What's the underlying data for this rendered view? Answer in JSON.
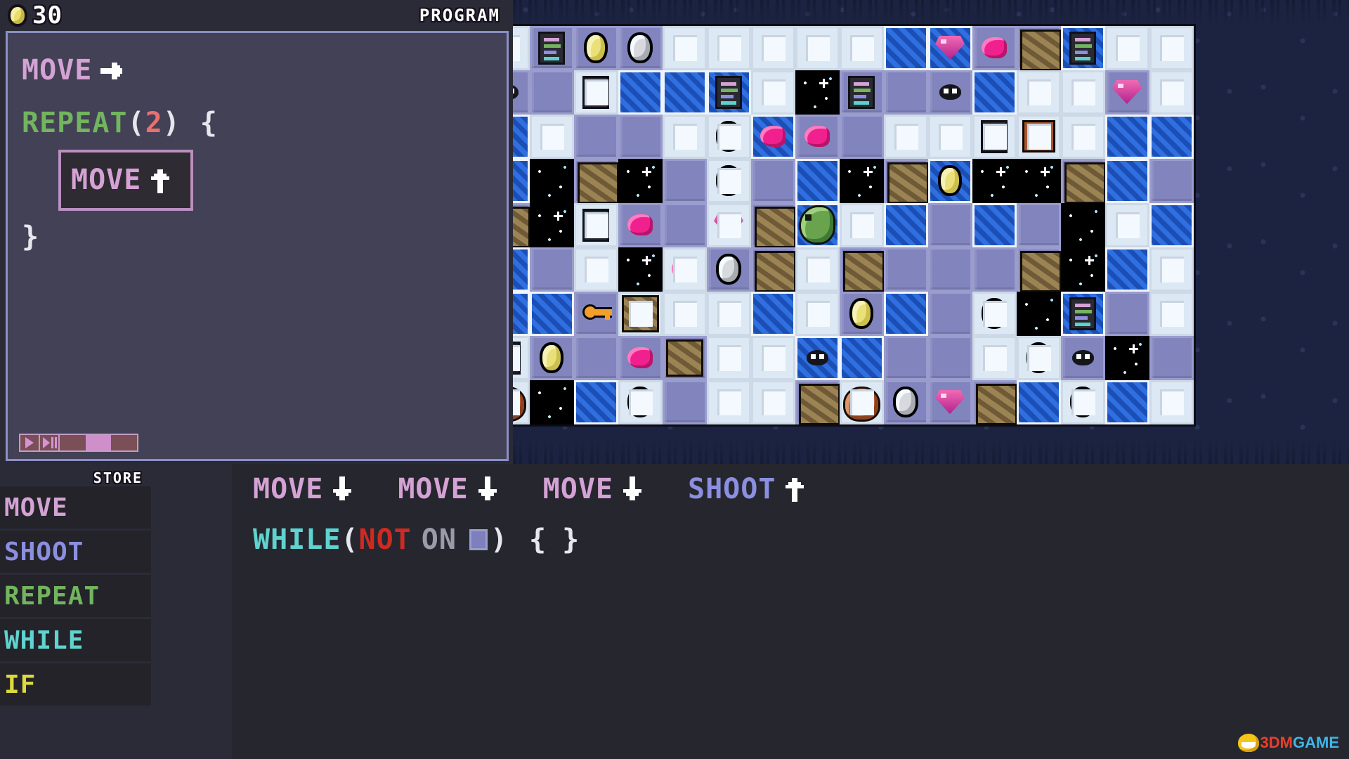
{
  "header": {
    "coin_count": "30",
    "program_label": "PROGRAM",
    "coin_icon": "coin-icon"
  },
  "program": {
    "lines": [
      {
        "keyword": "MOVE",
        "kind": "move",
        "arrow": "right",
        "selected": false,
        "indent": 0
      },
      {
        "keyword": "REPEAT",
        "kind": "repeat",
        "paren_open": "(",
        "count": "2",
        "paren_close": ")",
        "brace": "{",
        "indent": 0
      },
      {
        "keyword": "MOVE",
        "kind": "move",
        "arrow": "up",
        "selected": true,
        "indent": 1
      },
      {
        "brace_close": "}",
        "indent": 0
      }
    ],
    "transport": {
      "play_label": "play-button",
      "step_label": "step-button",
      "speed_segments": 3,
      "speed_active_index": 1
    }
  },
  "store": {
    "title": "STORE",
    "items": [
      {
        "label": "MOVE",
        "color": "#d4a2d4"
      },
      {
        "label": "SHOOT",
        "color": "#8c8fe0"
      },
      {
        "label": "REPEAT",
        "color": "#72b45f"
      },
      {
        "label": "WHILE",
        "color": "#5fd3cf"
      },
      {
        "label": "IF",
        "color": "#ddd93f"
      }
    ]
  },
  "tray": {
    "row1": [
      {
        "label": "MOVE",
        "kind": "move",
        "arrow": "down"
      },
      {
        "label": "MOVE",
        "kind": "move",
        "arrow": "down"
      },
      {
        "label": "MOVE",
        "kind": "move",
        "arrow": "down"
      },
      {
        "label": "SHOOT",
        "kind": "shoot",
        "arrow": "up"
      }
    ],
    "row2": {
      "while": "WHILE",
      "paren_open": "(",
      "not": "NOT",
      "on": "ON",
      "tile_icon": "purple-tile-icon",
      "paren_close": ")",
      "brace_open": "{",
      "brace_close": "}"
    }
  },
  "board": {
    "cols": 16,
    "rows": 9,
    "tiles": [
      [
        "light",
        "purple:tablet",
        "purple:coin",
        "purple:orb",
        "light",
        "light",
        "light",
        "light",
        "light",
        "blue",
        "blue:gem",
        "purple:blob",
        "rock",
        "blue:tablet",
        "light",
        "light"
      ],
      [
        "purple:bug",
        "purple",
        "light:tablet",
        "blue",
        "blue",
        "blue:tablet",
        "light",
        "space:spark",
        "purple:tablet",
        "purple",
        "purple:bug",
        "blue",
        "light",
        "light",
        "purple:gem",
        "light"
      ],
      [
        "blue",
        "light",
        "purple",
        "purple",
        "light",
        "light:orb",
        "blue:blob",
        "purple:blob",
        "purple",
        "light",
        "light",
        "light:tablet",
        "chest",
        "light:bug",
        "blue",
        "blue"
      ],
      [
        "blue",
        "space",
        "rock:tower",
        "space:spark",
        "purple",
        "light:orb",
        "purple",
        "blue",
        "space:spark",
        "rock",
        "blue:coin",
        "space:spark",
        "space:spark",
        "rock",
        "blue",
        "purple"
      ],
      [
        "rock",
        "space:spark",
        "light:tablet",
        "purple:blob",
        "purple",
        "light:gem",
        "rock",
        "blue:dragon",
        "light",
        "blue",
        "purple",
        "blue",
        "purple",
        "space",
        "light",
        "blue"
      ],
      [
        "blue",
        "purple",
        "light",
        "space:spark",
        "light:blob",
        "purple:orb",
        "rock",
        "light",
        "rock:tower",
        "purple",
        "purple",
        "purple",
        "rock",
        "space:spark",
        "blue",
        "light"
      ],
      [
        "blue",
        "blue",
        "purple:key",
        "light:rock",
        "light",
        "light",
        "blue",
        "light",
        "purple:coin",
        "blue",
        "purple",
        "light:orb",
        "space",
        "blue:tablet",
        "purple",
        "light"
      ],
      [
        "light:tablet",
        "purple:coin",
        "purple",
        "purple:blob",
        "purple:rock",
        "light",
        "light",
        "blue:bug",
        "blue",
        "purple",
        "purple",
        "light",
        "light:coin",
        "purple:bug",
        "space:spark",
        "purple"
      ],
      [
        "light:boulder",
        "space",
        "blue",
        "light:orb",
        "purple",
        "light:bug",
        "light",
        "rock:tower",
        "light:boulder",
        "purple:orb",
        "purple:gem",
        "rock",
        "blue",
        "light:orb",
        "blue",
        "light"
      ]
    ]
  },
  "watermark": {
    "part_a": "3DM",
    "part_b": "GAME"
  }
}
